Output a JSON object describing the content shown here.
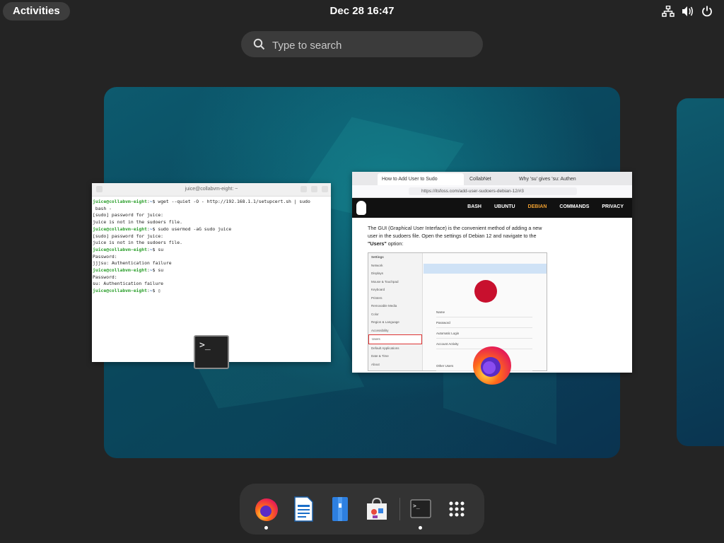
{
  "topbar": {
    "activities_label": "Activities",
    "clock": "Dec 28  16:47",
    "icons": [
      "network-icon",
      "volume-icon",
      "power-icon"
    ]
  },
  "search": {
    "placeholder": "Type to search"
  },
  "terminal": {
    "title": "juice@collabvm-eight: ~",
    "lines": [
      {
        "prompt": "juice@collabvm-eight",
        "path": "~",
        "cmd": "$ wget --quiet -O - http://192.168.1.1/setupcert.sh | sudo"
      },
      {
        "text": " bash -"
      },
      {
        "text": "[sudo] password for juice:"
      },
      {
        "text": "juice is not in the sudoers file."
      },
      {
        "prompt": "juice@collabvm-eight",
        "path": "~",
        "cmd": "$ sudo usermod -aG sudo juice"
      },
      {
        "text": "[sudo] password for juice:"
      },
      {
        "text": "juice is not in the sudoers file."
      },
      {
        "prompt": "juice@collabvm-eight",
        "path": "~",
        "cmd": "$ su"
      },
      {
        "text": "Password:"
      },
      {
        "text": "jjjsu: Authentication failure"
      },
      {
        "prompt": "juice@collabvm-eight",
        "path": "~",
        "cmd": "$ su"
      },
      {
        "text": "Password:"
      },
      {
        "text": "su: Authentication failure"
      },
      {
        "prompt": "juice@collabvm-eight",
        "path": "~",
        "cmd": "$ ▯"
      }
    ]
  },
  "browser": {
    "tabs": [
      "How to Add User to Sudo",
      "CollabNet",
      "Why 'su' gives 'su: Authen"
    ],
    "url": "https://itsfoss.com/add-user-sudoers-debian-12/#3",
    "nav_links": [
      "BASH",
      "UBUNTU",
      "DEBIAN",
      "COMMANDS",
      "PRIVACY"
    ],
    "active_nav": "DEBIAN",
    "article_text": "The GUI (Graphical User Interface) is the convenient method of adding a new user in the sudoers file. Open the settings of Debian 12 and navigate to the",
    "article_bold": "\"Users\"",
    "article_tail": " option:",
    "settings_title": "Settings",
    "settings_items": [
      "Network",
      "Displays",
      "Mouse & Touchpad",
      "Keyboard",
      "Printers",
      "Removable Media",
      "Color",
      "Region & Language",
      "Accessibility",
      "Users",
      "Default Applications",
      "Date & Time",
      "About"
    ],
    "settings_rows": [
      "Name",
      "Password",
      "Automatic Login",
      "Account Activity",
      "Other Users"
    ]
  },
  "dock": {
    "items": [
      "firefox-icon",
      "writer-icon",
      "files-icon",
      "software-icon",
      "terminal-icon",
      "app-grid-icon"
    ],
    "running": [
      "firefox-icon",
      "terminal-icon"
    ]
  },
  "colors": {
    "panel_bg": "#242424",
    "dock_bg": "#333333",
    "accent": "#f0a030"
  }
}
